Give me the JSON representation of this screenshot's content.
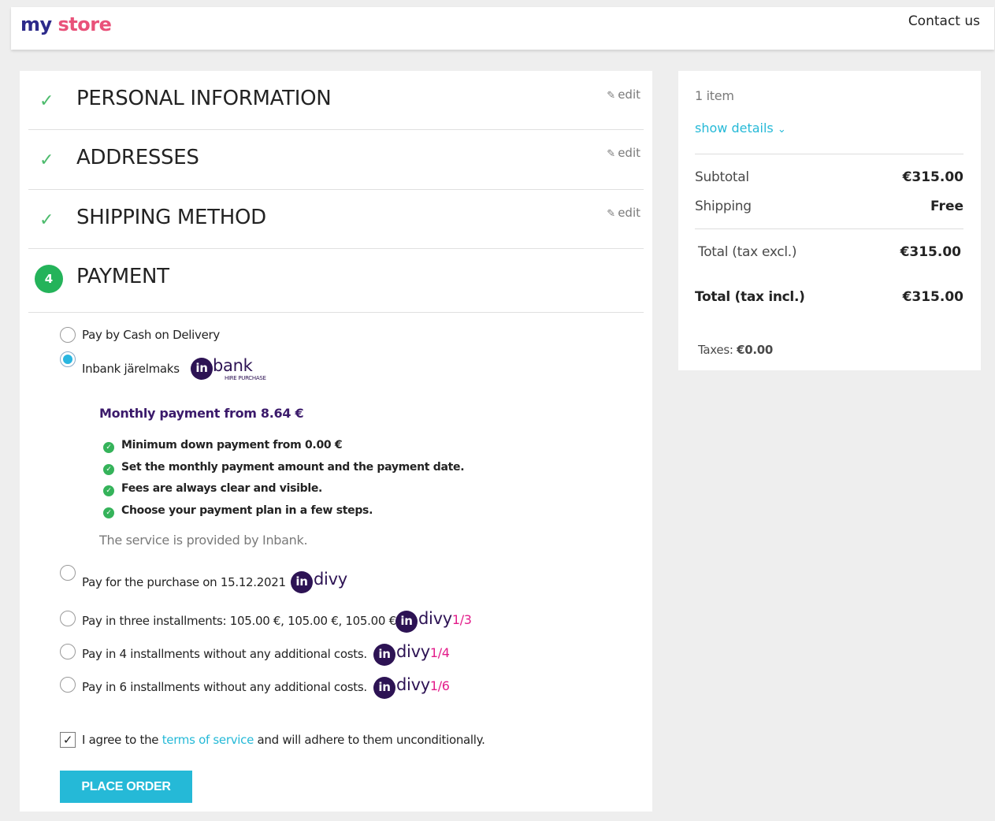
{
  "header": {
    "logo_my": "my",
    "logo_store": "store",
    "contact": "Contact us"
  },
  "steps": {
    "personal": {
      "title": "PERSONAL INFORMATION",
      "edit": "edit"
    },
    "addresses": {
      "title": "ADDRESSES",
      "edit": "edit"
    },
    "shipping": {
      "title": "SHIPPING METHOD",
      "edit": "edit"
    },
    "payment": {
      "number": "4",
      "title": "PAYMENT"
    }
  },
  "payment_options": {
    "cod": "Pay by Cash on Delivery",
    "inbank": "Inbank järelmaks",
    "inbank_brand": "bank",
    "inbank_brand_sub": "HIRE PURCHASE",
    "later": "Pay for the purchase on 15.12.2021",
    "three": "Pay in three installments: 105.00 €, 105.00 €, 105.00 €.",
    "four": "Pay in 4 installments without any additional costs.",
    "six": "Pay in 6 installments without any additional costs.",
    "divy": "divy",
    "frac3": "1/3",
    "frac4": "1/4",
    "frac6": "1/6",
    "badge": "in"
  },
  "inbank_details": {
    "monthly": "Monthly payment from 8.64 €",
    "features": [
      "Minimum down payment from 0.00 €",
      "Set the monthly payment amount and the payment date.",
      "Fees are always clear and visible.",
      "Choose your payment plan in a few steps."
    ],
    "provided": "The service is provided by Inbank."
  },
  "terms": {
    "before": "I agree to the ",
    "link": "terms of service",
    "after": " and will adhere to them unconditionally."
  },
  "place_order": "PLACE ORDER",
  "summary": {
    "items": "1 item",
    "show_details": "show details",
    "subtotal_label": "Subtotal",
    "subtotal_value": "€315.00",
    "shipping_label": "Shipping",
    "shipping_value": "Free",
    "total_excl_label": "Total (tax excl.)",
    "total_excl_value": "€315.00",
    "total_incl_label": "Total (tax incl.)",
    "total_incl_value": "€315.00",
    "taxes_label": "Taxes: ",
    "taxes_value": "€0.00"
  },
  "colors": {
    "accent": "#25b9d7",
    "success": "#24b35a",
    "inbank": "#2d1354",
    "divy_fraction": "#e31c8a"
  }
}
